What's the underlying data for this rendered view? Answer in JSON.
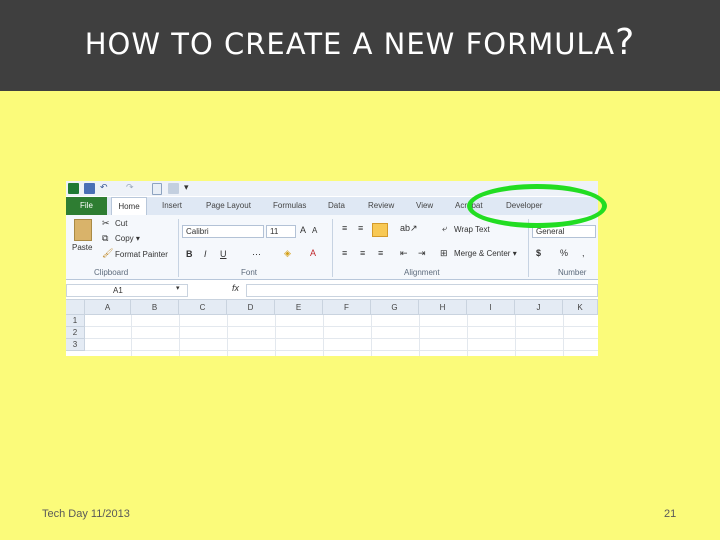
{
  "slide": {
    "title": "How to create a new formula",
    "title_mark": "?",
    "footer_left": "Tech Day 11/2013",
    "page_number": "21"
  },
  "excel": {
    "tabs": {
      "file": "File",
      "home": "Home",
      "insert": "Insert",
      "page_layout": "Page Layout",
      "formulas": "Formulas",
      "data": "Data",
      "review": "Review",
      "view": "View",
      "acrobat": "Acrobat",
      "developer": "Developer"
    },
    "clipboard": {
      "paste": "Paste",
      "cut": "Cut",
      "copy": "Copy ▾",
      "format_painter": "Format Painter",
      "label": "Clipboard"
    },
    "font": {
      "name": "Calibri",
      "size": "11",
      "label": "Font"
    },
    "alignment": {
      "wrap_text": "Wrap Text",
      "merge_center": "Merge & Center ▾",
      "label": "Alignment"
    },
    "number": {
      "format": "General",
      "label": "Number"
    },
    "name_box": "A1",
    "fx": "fx",
    "columns": [
      "A",
      "B",
      "C",
      "D",
      "E",
      "F",
      "G",
      "H",
      "I",
      "J",
      "K"
    ],
    "rows": [
      "1",
      "2",
      "3"
    ]
  },
  "colors": {
    "background": "#fbfb7a",
    "title_bar": "#3f3f3f",
    "highlight": "#22dd22",
    "file_tab": "#2e7d32"
  }
}
